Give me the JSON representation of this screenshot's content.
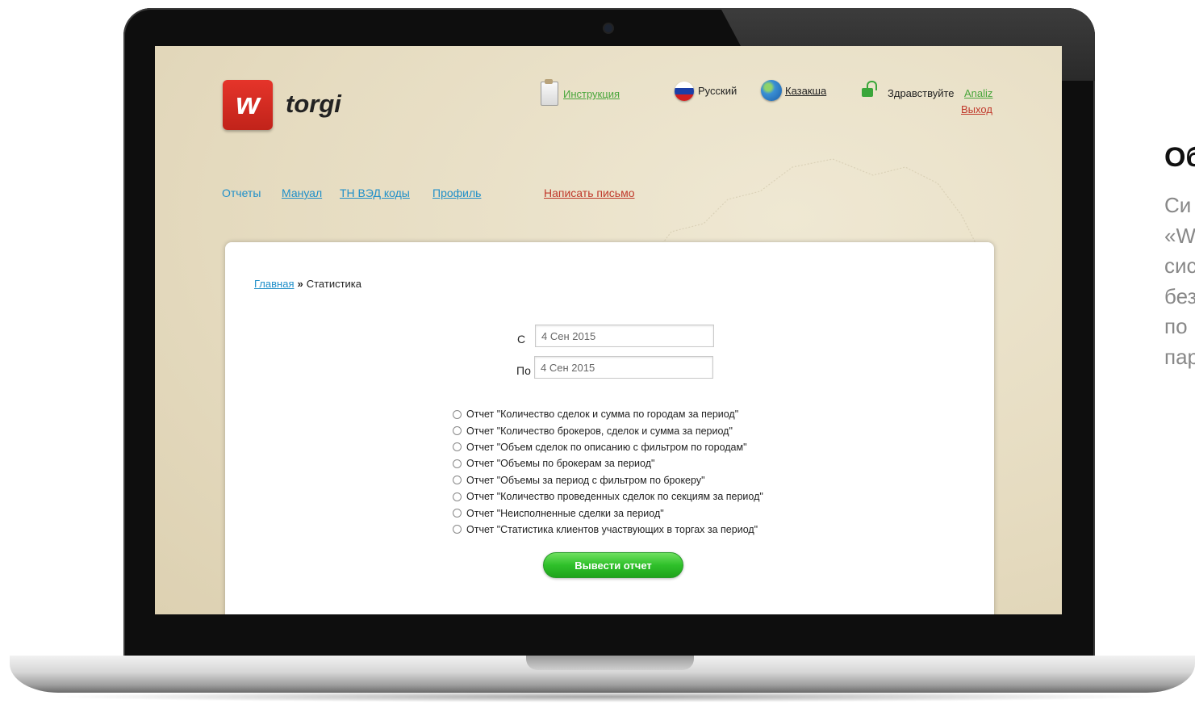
{
  "logo": {
    "mark": "w",
    "name": "torgi"
  },
  "header": {
    "instructions": "Инструкция",
    "lang_ru": "Русский",
    "lang_kz": "Казакша",
    "greeting": "Здравствуйте",
    "username": "Analiz",
    "logout": "Выход"
  },
  "nav": {
    "reports": "Отчеты",
    "manual": "Мануал",
    "codes": "ТН ВЭД коды",
    "profile": "Профиль",
    "write_letter": "Написать письмо"
  },
  "breadcrumb": {
    "home": "Главная",
    "separator": "»",
    "current": "Статистика"
  },
  "form": {
    "from_label": "С",
    "from_value": "4 Сен 2015",
    "to_label": "По",
    "to_value": "4 Сен 2015",
    "reports": [
      "Отчет \"Количество сделок и сумма по городам за период\"",
      "Отчет \"Количество брокеров, сделок и сумма за период\"",
      "Отчет \"Объем сделок по описанию с фильтром по городам\"",
      "Отчет \"Объемы по брокерам за период\"",
      "Отчет \"Объемы за период с фильтром по брокеру\"",
      "Отчет \"Количество проведенных сделок по секциям за период\"",
      "Отчет \"Неисполненные сделки за период\"",
      "Отчет \"Статистика клиентов участвующих в торгах за период\""
    ],
    "submit": "Вывести отчет"
  },
  "side": {
    "title": "Об",
    "lines": [
      "Си",
      "«W",
      "сис",
      "без",
      "по",
      "пар"
    ]
  },
  "colors": {
    "brand_red": "#d42b21",
    "link_blue": "#1f8fc9",
    "link_green": "#4aa63c",
    "button_green": "#2fc02a"
  }
}
